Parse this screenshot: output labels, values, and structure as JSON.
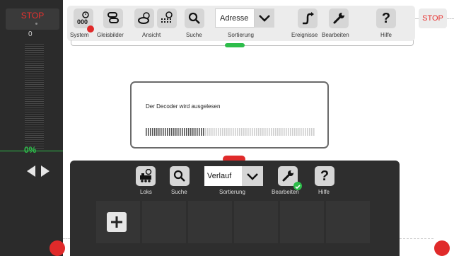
{
  "left_panel": {
    "stop_label": "STOP",
    "speed_value": "0",
    "speed_percent": "0%"
  },
  "toolbar": {
    "buttons": [
      {
        "label": "System",
        "icon": "clock-decoder-icon"
      },
      {
        "label": "Gleisbilder",
        "icon": "track-layout-icon"
      },
      {
        "label": "Ansicht",
        "icon": "view-icon"
      },
      {
        "label": "Suche",
        "icon": "search-icon"
      },
      {
        "label": "Sortierung",
        "icon": "chevron-down-icon",
        "value": "Adresse"
      },
      {
        "label": "Ereignisse",
        "icon": "events-icon"
      },
      {
        "label": "Bearbeiten",
        "icon": "wrench-icon"
      },
      {
        "label": "Hilfe",
        "icon": "help-icon"
      }
    ],
    "stop_label": "STOP"
  },
  "dialog": {
    "message": "Der Decoder wird ausgelesen",
    "progress": 0.35
  },
  "bottom_panel": {
    "buttons": [
      {
        "label": "Loks",
        "icon": "locomotive-icon"
      },
      {
        "label": "Suche",
        "icon": "search-icon"
      },
      {
        "label": "Sortierung",
        "icon": "chevron-down-icon",
        "value": "Verlauf"
      },
      {
        "label": "Bearbeiten",
        "icon": "wrench-icon"
      },
      {
        "label": "Hilfe",
        "icon": "help-icon"
      }
    ]
  },
  "colors": {
    "stop_red": "#e8312f",
    "accent_green": "#2dbd4a",
    "panel_dark": "#2e2e2e"
  }
}
